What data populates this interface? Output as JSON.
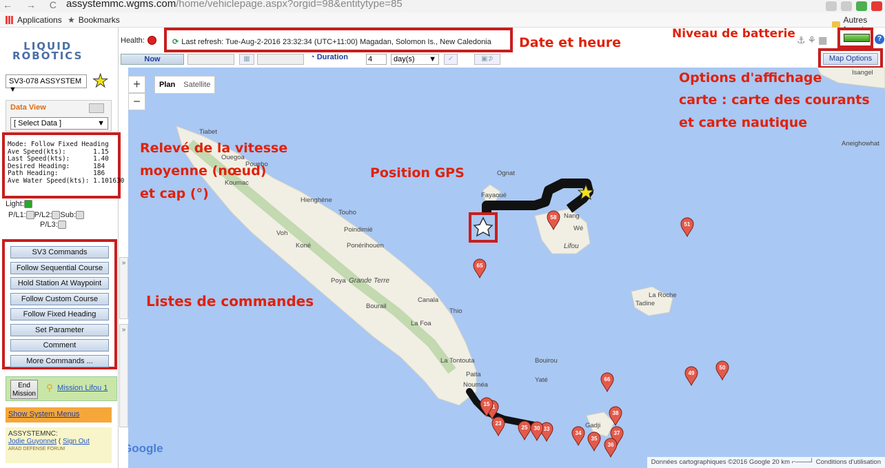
{
  "browser": {
    "url_host": "assystemmc.wgms.com",
    "url_path": "/home/vehiclepage.aspx?orgid=98&entitytype=85",
    "bookmarks": [
      {
        "label": "Applications"
      },
      {
        "label": "Bookmarks"
      }
    ],
    "other_bookmarks": "Autres favoris"
  },
  "sidebar": {
    "logo_line1": "LIQUID",
    "logo_line2": "ROBOTICS",
    "vehicle_select": "SV3-078 ASSYSTEM",
    "data_view_title": "Data View",
    "data_select": "[ Select Data ]",
    "status_lines": [
      "Mode: Follow Fixed Heading",
      "Ave Speed(kts):       1.15",
      "Last Speed(kts):      1.40",
      "Desired Heading:      184",
      "Path Heading:         186",
      "Ave Water Speed(kts): 1.101630"
    ],
    "light_label": "Light:",
    "pl1_label": "P/L1:",
    "pl2_label": "P/L2:",
    "sub_label": "Sub:",
    "pl3_label": "P/L3:",
    "commands": [
      "SV3 Commands",
      "Follow Sequential Course",
      "Hold Station At Waypoint",
      "Follow Custom Course",
      "Follow Fixed Heading",
      "Set Parameter",
      "Comment",
      "More Commands ..."
    ],
    "end_mission": "End Mission",
    "mission_link": "Mission Lifou 1",
    "system_menus": "Show System Menus",
    "org_label": "ASSYSTEMNC:",
    "user_name": "Jodie Guyonnet",
    "sign_out": "Sign Out",
    "watermark": "ARAD DEFENSE FORUM"
  },
  "toolbar": {
    "health_label": "Health:",
    "last_refresh": "Last refresh: Tue-Aug-2-2016 23:32:34 (UTC+11:00) Magadan, Solomon Is., New Caledonia",
    "now_label": "Now",
    "duration_label": "Duration",
    "duration_value": "4",
    "duration_unit": "day(s)",
    "map_options": "Map Options"
  },
  "map": {
    "zoom_in": "+",
    "zoom_out": "−",
    "type_plan": "Plan",
    "type_satellite": "Satellite",
    "google_logo": "Google",
    "attribution": "Données cartographiques ©2016 Google   20 km ⌐───┘   Conditions d'utilisation",
    "places": [
      {
        "name": "Isangel"
      },
      {
        "name": "Aneighowhat"
      },
      {
        "name": "Tiabet"
      },
      {
        "name": "Ouegoa"
      },
      {
        "name": "Pouebo"
      },
      {
        "name": "Koumac"
      },
      {
        "name": "Hienghène"
      },
      {
        "name": "Touho"
      },
      {
        "name": "Poindimié"
      },
      {
        "name": "Voh"
      },
      {
        "name": "Koné"
      },
      {
        "name": "Ponérihouen"
      },
      {
        "name": "Poya"
      },
      {
        "name": "Grande Terre"
      },
      {
        "name": "Bourail"
      },
      {
        "name": "Canala"
      },
      {
        "name": "Thio"
      },
      {
        "name": "La Foa"
      },
      {
        "name": "La Tontouta"
      },
      {
        "name": "Paita"
      },
      {
        "name": "Nouméa"
      },
      {
        "name": "Yaté"
      },
      {
        "name": "Gadji"
      },
      {
        "name": "Ognat"
      },
      {
        "name": "Fayaoué"
      },
      {
        "name": "Nang"
      },
      {
        "name": "Wé"
      },
      {
        "name": "Lifou"
      },
      {
        "name": "La Roche"
      },
      {
        "name": "Tadine"
      },
      {
        "name": "Bouirou"
      }
    ],
    "markers": [
      {
        "label": "58"
      },
      {
        "label": "51"
      },
      {
        "label": "65"
      },
      {
        "label": "66"
      },
      {
        "label": "49"
      },
      {
        "label": "50"
      },
      {
        "label": "38"
      },
      {
        "label": "37"
      },
      {
        "label": "36"
      },
      {
        "label": "35"
      },
      {
        "label": "34"
      },
      {
        "label": "33"
      },
      {
        "label": "30"
      },
      {
        "label": "25"
      },
      {
        "label": "23"
      },
      {
        "label": "21"
      },
      {
        "label": "15"
      }
    ]
  },
  "annotations": {
    "date": "Date et heure",
    "battery": "Niveau de batterie",
    "map_options_l1": "Options d'affichage",
    "map_options_l2": "carte : carte des courants",
    "map_options_l3": "et  carte nautique",
    "speed_l1": "Relevé de la vitesse",
    "speed_l2": "moyenne (nœud)",
    "speed_l3": "et cap (°)",
    "gps": "Position GPS",
    "commands": "Listes de commandes"
  },
  "colors": {
    "annotation_red": "#e0210b",
    "highlight_box": "#c81e1e",
    "sea": "#a9c8f3",
    "land": "#f1efe4",
    "marker": "#e35a4b"
  }
}
